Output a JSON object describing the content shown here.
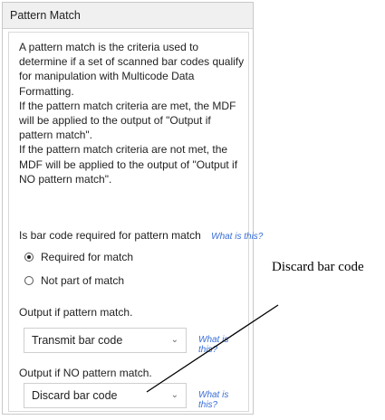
{
  "panel": {
    "title": "Pattern Match",
    "description": [
      "A pattern match is the criteria used to determine if a set of scanned bar codes qualify for manipulation with Multicode Data Formatting.",
      "If the pattern match criteria are met, the MDF will be applied to the output of \"Output if pattern match\".",
      "If the pattern match criteria are not met, the MDF will be applied to the output of \"Output if NO pattern match\"."
    ],
    "required_question": "Is bar code required for pattern match",
    "what_is_this": "What is this?",
    "radio_options": [
      {
        "label": "Required for match",
        "checked": true
      },
      {
        "label": "Not part of match",
        "checked": false
      }
    ],
    "output_match_label": "Output if pattern match.",
    "output_match_value": "Transmit bar code",
    "output_nomatch_label": "Output if NO pattern match.",
    "output_nomatch_value": "Discard bar code"
  },
  "callout": {
    "text": "Discard bar code"
  }
}
